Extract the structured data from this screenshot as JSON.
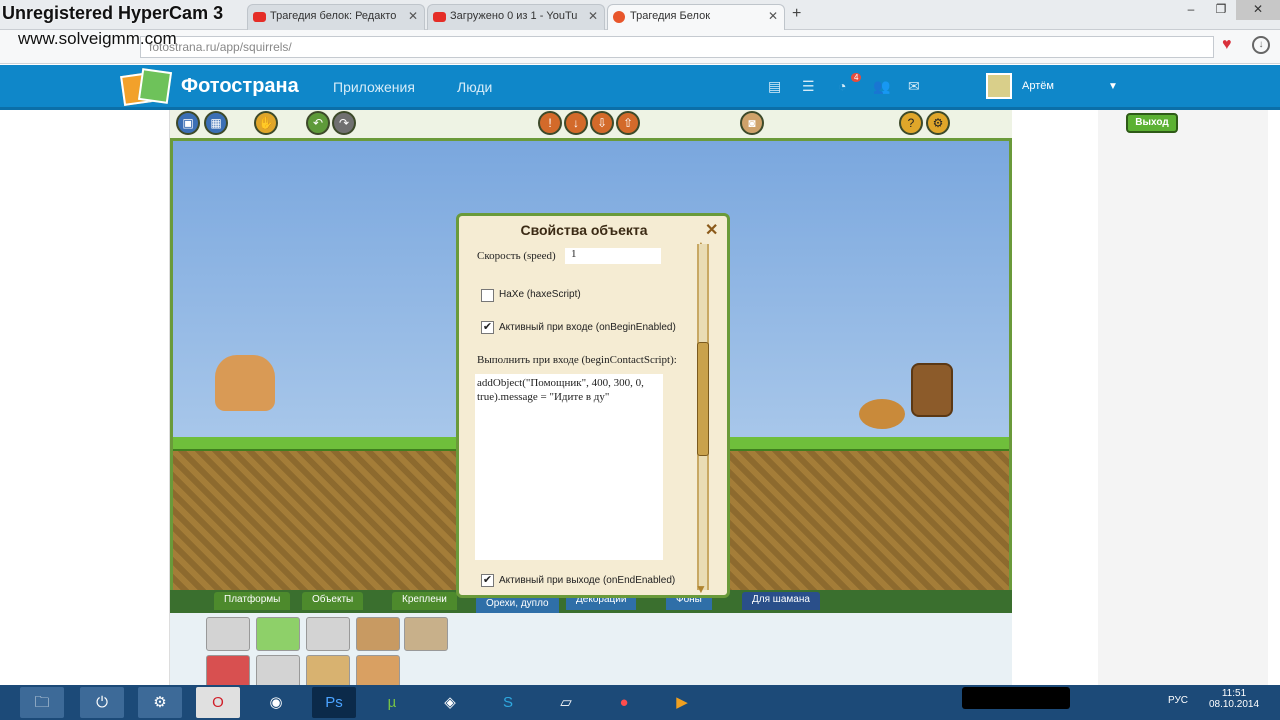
{
  "watermark": {
    "line1": "Unregistered HyperCam 3",
    "line2": "www.solveigmm.com"
  },
  "browser": {
    "tabs": [
      {
        "label": "Трагедия белок: Редакто",
        "favicon": "youtube-icon"
      },
      {
        "label": "Загружено 0 из 1 - YouTu",
        "favicon": "youtube-icon"
      },
      {
        "label": "Трагедия Белок",
        "favicon": "fotostrana-icon",
        "active": true
      }
    ],
    "new_tab": "+",
    "address": "fotostrana.ru/app/squirrels/",
    "window_buttons": [
      "–",
      "❐",
      "✕"
    ]
  },
  "site": {
    "brand": "Фотострана",
    "nav": [
      "Приложения",
      "Люди"
    ],
    "notification_count": "4",
    "user_name": "Артём"
  },
  "game": {
    "exit_label": "Выход",
    "bottom_tabs": [
      "Платформы",
      "Объекты",
      "Креплени",
      "Орехи, дупло",
      "Декорации",
      "Фоны",
      "Для шамана"
    ]
  },
  "dialog": {
    "title": "Свойства объекта",
    "close": "✕",
    "speed_label": "Скорость (speed)",
    "speed_value": "1",
    "haxe_label": "HaXe (haxeScript)",
    "haxe_checked": false,
    "on_begin_label": "Активный при входе (onBeginEnabled)",
    "on_begin_checked": true,
    "begin_script_label": "Выполнить при входе (beginContactScript):",
    "begin_script_value": "addObject(\"Помощник\", 400, 300, 0,\ntrue).message = \"Идите в ду\"",
    "on_end_label": "Активный при выходе (onEndEnabled)",
    "on_end_checked": true
  },
  "taskbar": {
    "language": "РУС",
    "time": "11:51",
    "date": "08.10.2014"
  },
  "colors": {
    "site_header": "#0f87c9",
    "game_border": "#6a9a3a",
    "taskbar": "#1c4a78"
  }
}
